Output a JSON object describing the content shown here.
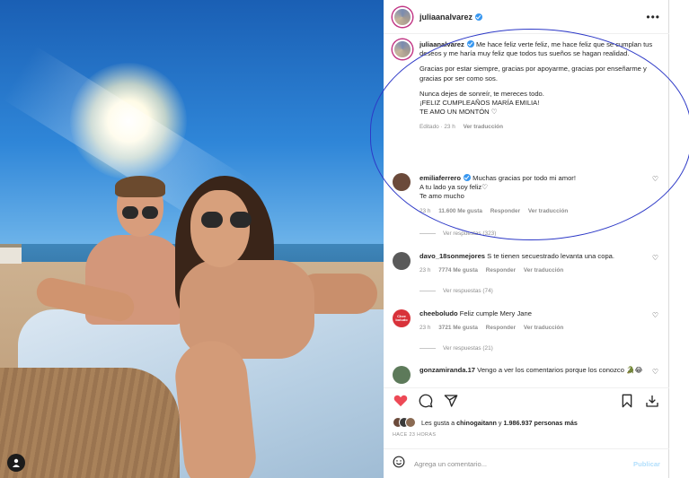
{
  "post": {
    "username": "juliaanalvarez",
    "caption": {
      "username": "juliaanalvarez",
      "p1": "Me hace feliz verte feliz, me hace feliz que se cumplan tus deseos y me haría muy feliz que todos tus sueños se hagan realidad.",
      "p2": "Gracias por estar siempre, gracias por apoyarme, gracias por enseñarme y gracias por ser como sos.",
      "p3": "Nunca dejes de sonreír, te mereces todo.",
      "p4": "¡FELIZ CUMPLEAÑOS MARÍA EMILIA!",
      "p5": "TE AMO UN MONTÓN ♡",
      "edited": "Editado · 23 h",
      "translate": "Ver traducción"
    },
    "comments": [
      {
        "username": "emiliaferrero",
        "text1": "Muchas gracias por todo mi amor!",
        "text2": "A tu lado ya soy feliz♡",
        "text3": "Te amo mucho",
        "time": "23 h",
        "likes": "11.600 Me gusta",
        "reply": "Responder",
        "translate": "Ver traducción",
        "replies": "Ver respuestas (323)",
        "avatar_color": "#6b4a3a"
      },
      {
        "username": "davo_18sonmejores",
        "text1": "S te tienen secuestrado levanta una copa.",
        "time": "23 h",
        "likes": "7774 Me gusta",
        "reply": "Responder",
        "translate": "Ver traducción",
        "replies": "Ver respuestas (74)",
        "avatar_color": "#5a5a5a"
      },
      {
        "username": "cheeboludo",
        "text1": "Feliz cumple Mery Jane",
        "time": "23 h",
        "likes": "3721 Me gusta",
        "reply": "Responder",
        "translate": "Ver traducción",
        "replies": "Ver respuestas (21)",
        "avatar_color": "#d8323a",
        "avatar_text": "Chee boludo"
      },
      {
        "username": "gonzamiranda.17",
        "text1": "Vengo a ver los comentarios porque los conozco 🐊😂",
        "avatar_color": "#5d7a5a"
      }
    ],
    "likes_line": {
      "prefix": "Les gusta a",
      "user": "chinogaitann",
      "middle": "y",
      "count": "1.986.937 personas más"
    },
    "time_ago": "HACE 23 HORAS",
    "add_comment_placeholder": "Agrega un comentario...",
    "publish_label": "Publicar"
  },
  "colors": {
    "verified": "#3897f0",
    "like_red": "#ed4956",
    "annotation": "#2d39c7"
  }
}
